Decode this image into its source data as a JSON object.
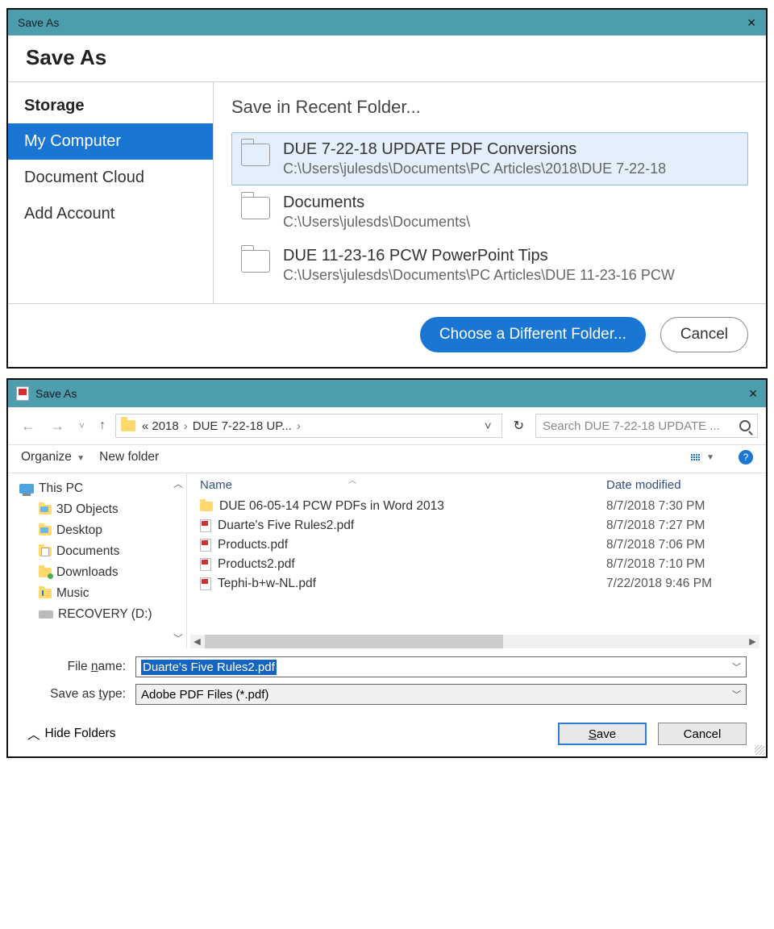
{
  "dialog1": {
    "titlebar": "Save As",
    "header": "Save As",
    "sidebar": {
      "heading": "Storage",
      "items": [
        "My Computer",
        "Document Cloud",
        "Add Account"
      ]
    },
    "recent_title": "Save in Recent Folder...",
    "folders": [
      {
        "name": "DUE 7-22-18 UPDATE PDF Conversions",
        "path": "C:\\Users\\julesds\\Documents\\PC Articles\\2018\\DUE 7-22-18 "
      },
      {
        "name": "Documents",
        "path": "C:\\Users\\julesds\\Documents\\"
      },
      {
        "name": "DUE 11-23-16 PCW PowerPoint Tips",
        "path": "C:\\Users\\julesds\\Documents\\PC Articles\\DUE 11-23-16 PCW"
      }
    ],
    "choose_button": "Choose a Different Folder...",
    "cancel_button": "Cancel"
  },
  "dialog2": {
    "titlebar": "Save As",
    "breadcrumb": {
      "prefix": "«",
      "p1": "2018",
      "p2": "DUE 7-22-18 UP..."
    },
    "search_placeholder": "Search DUE 7-22-18 UPDATE ...",
    "organize": "Organize",
    "new_folder": "New folder",
    "tree": [
      "This PC",
      "3D Objects",
      "Desktop",
      "Documents",
      "Downloads",
      "Music",
      "RECOVERY (D:)"
    ],
    "columns": {
      "name": "Name",
      "date": "Date modified"
    },
    "files": [
      {
        "name": "DUE 06-05-14 PCW PDFs in Word 2013",
        "date": "8/7/2018 7:30 PM",
        "kind": "folder"
      },
      {
        "name": "Duarte's Five Rules2.pdf",
        "date": "8/7/2018 7:27 PM",
        "kind": "pdf"
      },
      {
        "name": "Products.pdf",
        "date": "8/7/2018 7:06 PM",
        "kind": "pdf"
      },
      {
        "name": "Products2.pdf",
        "date": "8/7/2018 7:10 PM",
        "kind": "pdf"
      },
      {
        "name": "Tephi-b+w-NL.pdf",
        "date": "7/22/2018 9:46 PM",
        "kind": "pdf"
      }
    ],
    "filename_label": "File name:",
    "filename_value": "Duarte's Five Rules2.pdf",
    "type_label": "Save as type:",
    "type_value": "Adobe PDF Files (*.pdf)",
    "hide_folders": "Hide Folders",
    "save_button": "Save",
    "cancel_button": "Cancel"
  }
}
